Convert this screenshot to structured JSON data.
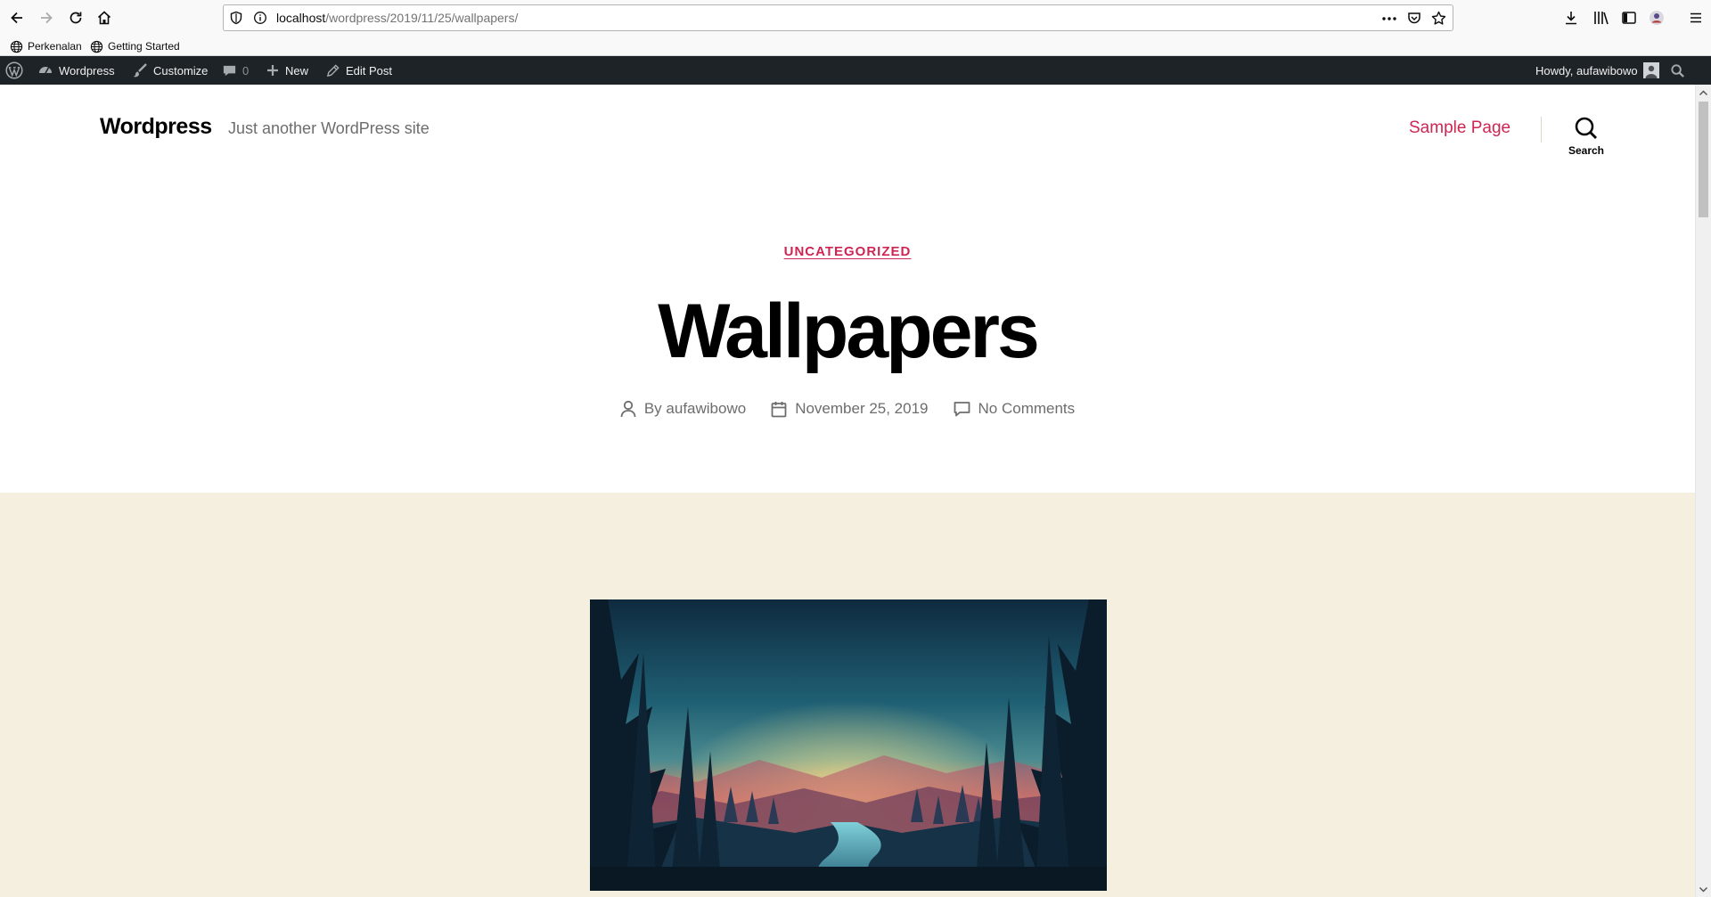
{
  "browser": {
    "url": {
      "host": "localhost",
      "path": "/wordpress/2019/11/25/wallpapers/"
    },
    "bookmarks": [
      "Perkenalan",
      "Getting Started"
    ]
  },
  "admin_bar": {
    "site_name": "Wordpress",
    "customize": "Customize",
    "comments_count": "0",
    "new": "New",
    "edit_post": "Edit Post",
    "howdy": "Howdy, aufawibowo"
  },
  "site": {
    "title": "Wordpress",
    "description": "Just another WordPress site",
    "nav_item": "Sample Page",
    "search_label": "Search"
  },
  "post": {
    "category": "UNCATEGORIZED",
    "title": "Wallpapers",
    "author": "By aufawibowo",
    "date": "November 25, 2019",
    "comments": "No Comments"
  },
  "colors": {
    "accent": "#cd2653",
    "admin_bar": "#1d2327",
    "featured_bg": "#f5efe0"
  }
}
